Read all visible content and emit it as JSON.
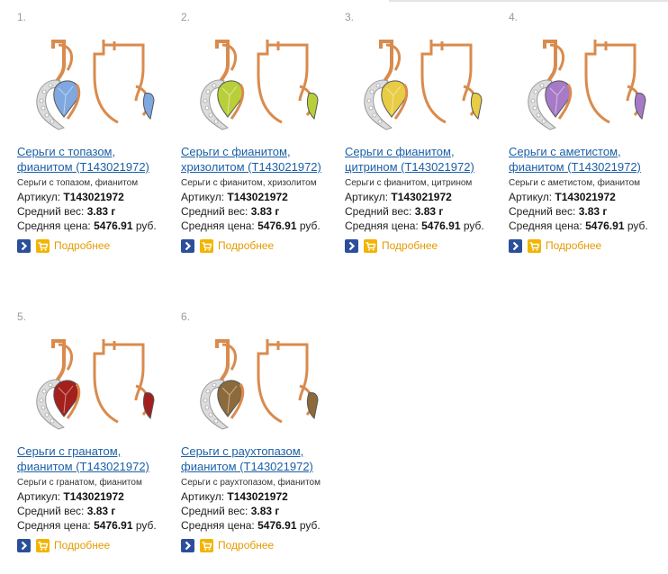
{
  "products": [
    {
      "num": "1.",
      "title_line1": "Серьги с топазом,",
      "title_line2": "фианитом (T143021972)",
      "desc": "Серьги с топазом, фианитом",
      "article_label": "Артикул:",
      "article": "T143021972",
      "weight_label": "Средний вес:",
      "weight": "3.83 г",
      "price_label": "Средняя цена:",
      "price": "5476.91",
      "currency": "руб.",
      "more": "Подробнее",
      "gem_color": "#7fa8e0"
    },
    {
      "num": "2.",
      "title_line1": "Серьги с фианитом,",
      "title_line2": "хризолитом (T143021972)",
      "desc": "Серьги с фианитом, хризолитом",
      "article_label": "Артикул:",
      "article": "T143021972",
      "weight_label": "Средний вес:",
      "weight": "3.83 г",
      "price_label": "Средняя цена:",
      "price": "5476.91",
      "currency": "руб.",
      "more": "Подробнее",
      "gem_color": "#b9cf3a"
    },
    {
      "num": "3.",
      "title_line1": "Серьги с фианитом,",
      "title_line2": "цитрином (T143021972)",
      "desc": "Серьги с фианитом, цитрином",
      "article_label": "Артикул:",
      "article": "T143021972",
      "weight_label": "Средний вес:",
      "weight": "3.83 г",
      "price_label": "Средняя цена:",
      "price": "5476.91",
      "currency": "руб.",
      "more": "Подробнее",
      "gem_color": "#e8cc45"
    },
    {
      "num": "4.",
      "title_line1": "Серьги с аметистом,",
      "title_line2": "фианитом (T143021972)",
      "desc": "Серьги с аметистом, фианитом",
      "article_label": "Артикул:",
      "article": "T143021972",
      "weight_label": "Средний вес:",
      "weight": "3.83 г",
      "price_label": "Средняя цена:",
      "price": "5476.91",
      "currency": "руб.",
      "more": "Подробнее",
      "gem_color": "#a77ac8"
    },
    {
      "num": "5.",
      "title_line1": "Серьги с гранатом,",
      "title_line2": "фианитом (T143021972)",
      "desc": "Серьги с гранатом, фианитом",
      "article_label": "Артикул:",
      "article": "T143021972",
      "weight_label": "Средний вес:",
      "weight": "3.83 г",
      "price_label": "Средняя цена:",
      "price": "5476.91",
      "currency": "руб.",
      "more": "Подробнее",
      "gem_color": "#a3201c"
    },
    {
      "num": "6.",
      "title_line1": "Серьги с раухтопазом,",
      "title_line2": "фианитом (T143021972)",
      "desc": "Серьги с раухтопазом, фианитом",
      "article_label": "Артикул:",
      "article": "T143021972",
      "weight_label": "Средний вес:",
      "weight": "3.83 г",
      "price_label": "Средняя цена:",
      "price": "5476.91",
      "currency": "руб.",
      "more": "Подробнее",
      "gem_color": "#8c6a3c"
    }
  ],
  "colors": {
    "link": "#1b5fa6",
    "more": "#e49b00",
    "gold": "#d98b4e",
    "arrow_button": "#2b4f9a",
    "cart_button": "#f2b400"
  },
  "icons": {
    "arrow": "chevron-right-icon",
    "cart": "cart-icon",
    "image": "earrings-image"
  }
}
